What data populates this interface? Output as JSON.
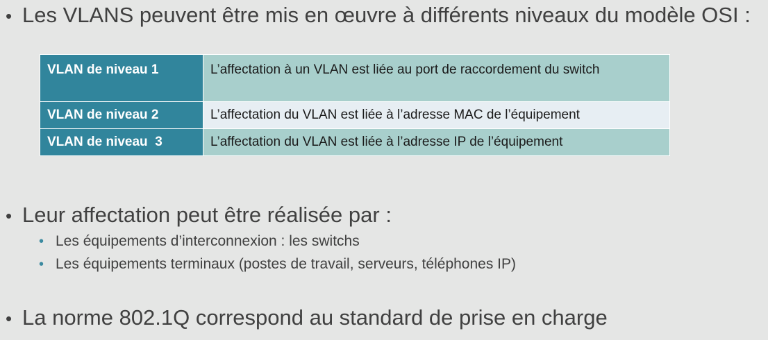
{
  "bullets": {
    "intro": "Les VLANS peuvent être mis en œuvre à différents niveaux du modèle OSI :",
    "affectation": "Leur affectation peut être réalisée par :",
    "norme": "La norme 802.1Q correspond au standard de prise en charge"
  },
  "table": {
    "rows": [
      {
        "level": "VLAN de niveau 1",
        "description": "L’affectation à un VLAN est liée au port de raccordement du switch"
      },
      {
        "level": "VLAN de niveau 2",
        "description": "L’affectation du VLAN est liée à l’adresse MAC de l’équipement"
      },
      {
        "level": "VLAN de niveau  3",
        "description": "L’affectation du VLAN est liée à l’adresse IP de l’équipement"
      }
    ]
  },
  "sub_bullets": [
    "Les équipements d’interconnexion : les switchs",
    "Les équipements terminaux (postes de travail, serveurs, téléphones IP)"
  ],
  "colors": {
    "background": "#e5e6e5",
    "header_cell": "#31859c",
    "row_teal": "#a8cfcc",
    "row_light": "#e7eef3",
    "sub_bullet_dot": "#3b8aa0"
  }
}
